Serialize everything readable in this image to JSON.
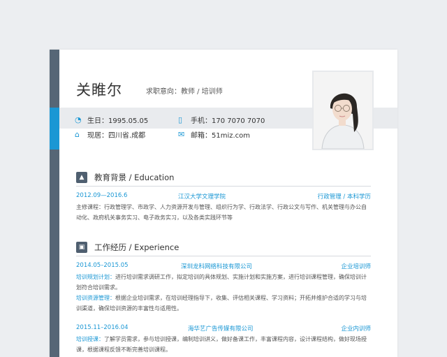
{
  "header": {
    "name": "关睢尔",
    "intent": "求职意向：教师 / 培训师"
  },
  "info": {
    "birth": "生日：1995.05.05",
    "phone": "手机：170 7070 7070",
    "residence": "现居：四川省.成都",
    "email": "邮箱：51miz.com"
  },
  "education": {
    "title": "教育背景 / Education",
    "date": "2012.09—2016.6",
    "school": "江汉大学文理学院",
    "major": "行政管理 / 本科学历",
    "desc": "主修课程：行政管理学、市政学、人力资源开发与管理、组织行为学、行政法学、行政公文与写作、机关管理与办公自动化、政府机关事务实习、电子政务实习，以及各类实践环节等"
  },
  "experience": {
    "title": "工作经历 / Experience",
    "jobs": [
      {
        "date": "2014.05–2015.05",
        "company": "深圳龙科网络科技有限公司",
        "position": "企业培训师",
        "p1_label": "培训规划计划：",
        "p1_text": "进行培训需求调研工作，拟定培训的具体规划、实施计划和实施方案，进行培训课程管理，确保培训计划符合培训需求。",
        "p2_label": "培训资源管理：",
        "p2_text": "根据企业培训需求，在培训经理指导下，收集、评估相关课程、学习资料；开拓并维护合适的学习与培训渠道，确保培训资源的丰富性与适用性。"
      },
      {
        "date": "2015.11–2016.04",
        "company": "海华艺广告传媒有限公司",
        "position": "企业内训师",
        "p1_label": "培训授课：",
        "p1_text": "了解学员需求，参与培训授课，编制培训讲义，做好备课工作，丰富课程内容，设计课程结构，做好现场授课，根据课程反馈不断完善培训课程。"
      }
    ]
  },
  "colors": {
    "accent": "#1a97d4",
    "sidebar": "#566676"
  },
  "icons": [
    "birthday-cake-icon",
    "phone-icon",
    "location-icon",
    "mail-icon",
    "graduation-cap-icon",
    "briefcase-icon"
  ]
}
